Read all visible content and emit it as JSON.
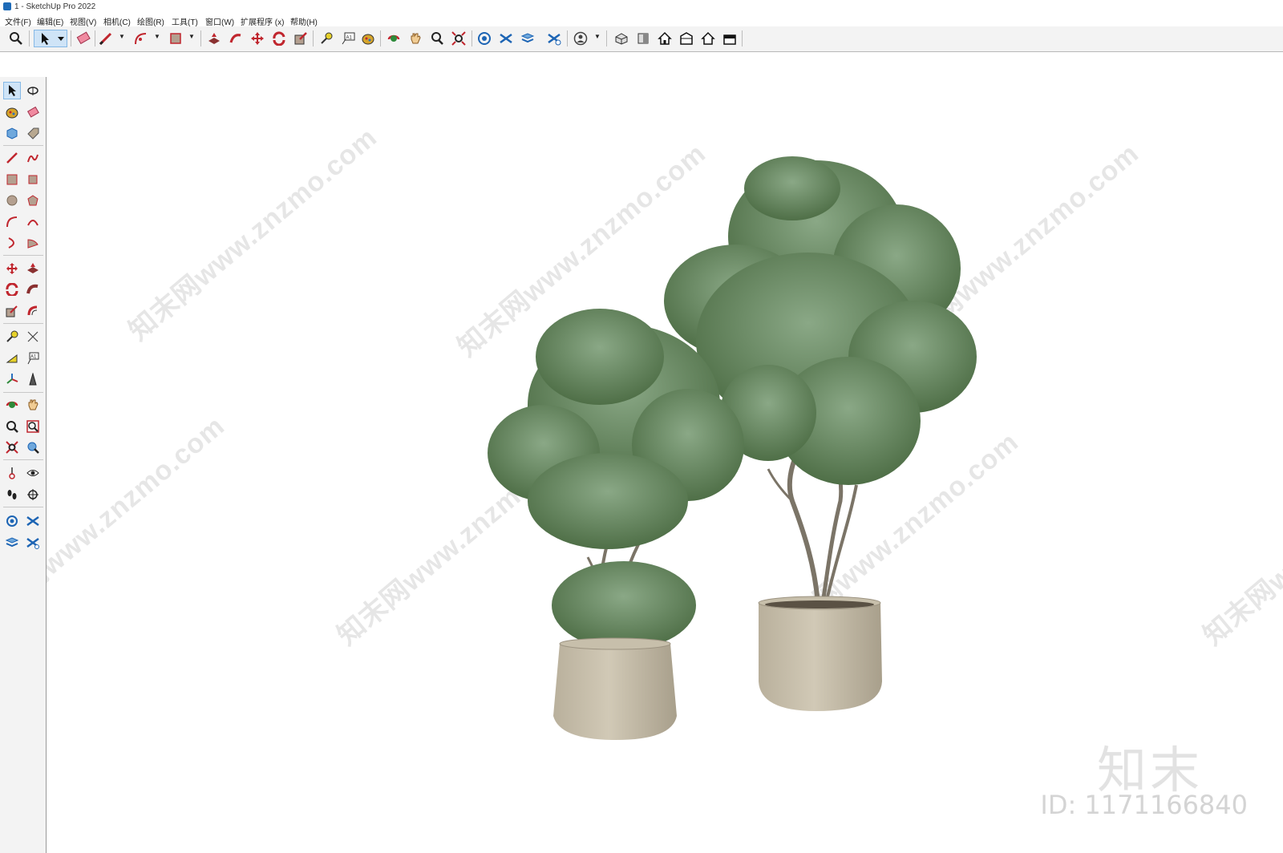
{
  "window": {
    "title": "1 - SketchUp Pro 2022"
  },
  "menu": [
    "文件(F)",
    "编辑(E)",
    "视图(V)",
    "相机(C)",
    "绘图(R)",
    "工具(T)",
    "窗口(W)",
    "扩展程序 (x)",
    "帮助(H)"
  ],
  "watermark": {
    "text": "知末网www.znzmo.com",
    "logo": "知末",
    "id": "ID: 1171166840"
  },
  "colors": {
    "foliage": "#5c7e52",
    "foliage_light": "#8aa886",
    "pot": "#c9c0ac",
    "trunk": "#7b7467"
  }
}
